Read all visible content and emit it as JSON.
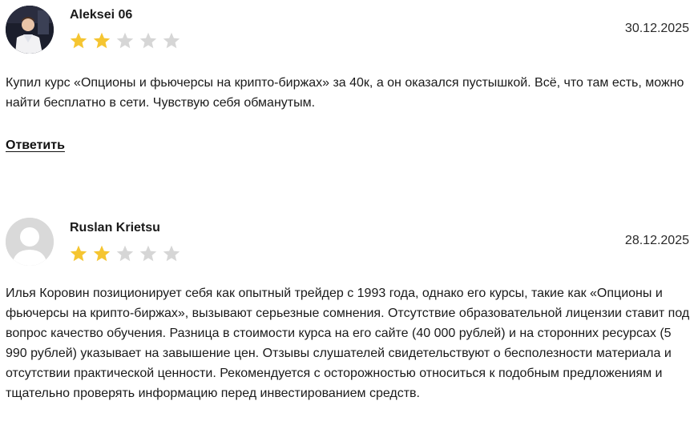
{
  "reviews": [
    {
      "author": "Aleksei 06",
      "date": "30.12.2025",
      "rating": 2,
      "max_rating": 5,
      "avatar_icon": "user-photo",
      "text": "Купил курс «Опционы и фьючерсы на крипто-биржах» за 40к, а он оказался пустышкой. Всё, что там есть, можно найти бесплатно в сети. Чувствую себя обманутым.",
      "reply_label": "Ответить"
    },
    {
      "author": "Ruslan Krietsu",
      "date": "28.12.2025",
      "rating": 2,
      "max_rating": 5,
      "avatar_icon": "default-user-avatar",
      "text": "Илья Коровин позиционирует себя как опытный трейдер с 1993 года, однако его курсы, такие как «Опционы и фьючерсы на крипто-биржах», вызывают серьезные сомнения. Отсутствие образовательной лицензии ставит под вопрос качество обучения. Разница в стоимости курса на его сайте (40 000 рублей) и на сторонних ресурсах (5 990 рублей) указывает на завышение цен. Отзывы слушателей свидетельствуют о бесполезности материала и отсутствии практической ценности. Рекомендуется с осторожностью относиться к подобным предложениям и тщательно проверять информацию перед инвестированием средств."
    }
  ],
  "colors": {
    "star_filled": "#f5c531",
    "star_empty": "#d6d6d6",
    "avatar_placeholder_bg": "#d9d9d9"
  }
}
